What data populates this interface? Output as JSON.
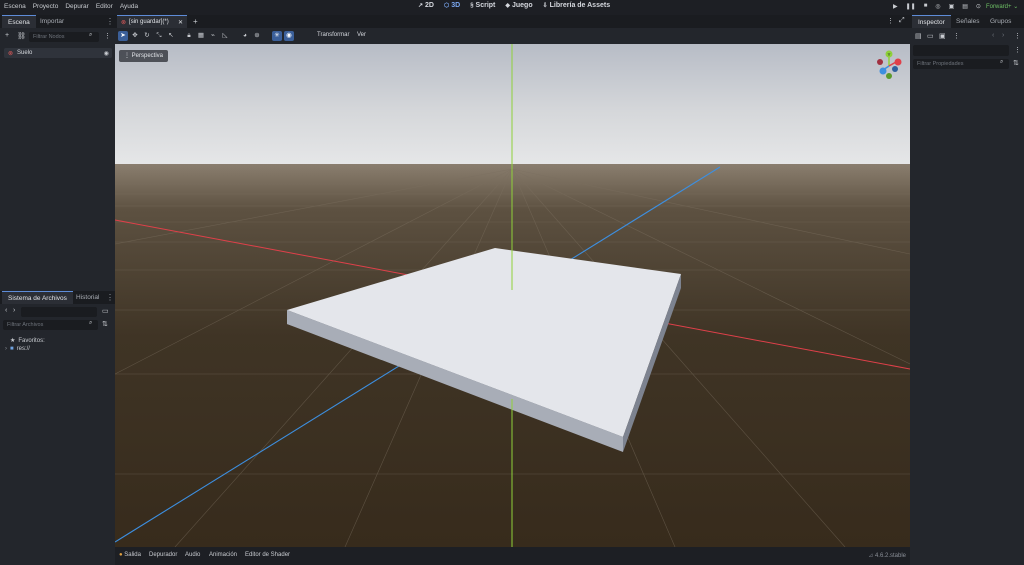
{
  "menubar": {
    "items": [
      "Escena",
      "Proyecto",
      "Depurar",
      "Editor",
      "Ayuda"
    ],
    "workspaces": [
      {
        "label": "2D",
        "icon": "2d-icon",
        "active": false
      },
      {
        "label": "3D",
        "icon": "3d-icon",
        "active": true
      },
      {
        "label": "Script",
        "icon": "script-icon",
        "active": false
      },
      {
        "label": "Juego",
        "icon": "game-icon",
        "active": false
      },
      {
        "label": "Librería de Assets",
        "icon": "assetlib-icon",
        "active": false
      }
    ],
    "renderer": "Forward+"
  },
  "scene_dock": {
    "tabs": [
      "Escena",
      "Importar"
    ],
    "filter_placeholder": "Filtrar Nodos",
    "tree": [
      {
        "label": "Suelo",
        "icon": "node3d-icon"
      }
    ]
  },
  "filesystem_dock": {
    "tabs": [
      "Sistema de Archivos",
      "Historial"
    ],
    "filter_placeholder": "Filtrar Archivos",
    "favorites_label": "Favoritos:",
    "root_label": "res://"
  },
  "editor": {
    "scene_tab_label": "[sin guardar](*)",
    "toolbar_menus": [
      "Transformar",
      "Ver"
    ],
    "perspective_label": "Perspectiva",
    "gizmo_labels": {
      "y": "Y"
    }
  },
  "inspector_dock": {
    "tabs": [
      "Inspector",
      "Señales",
      "Grupos"
    ],
    "filter_placeholder": "Filtrar Propiedades"
  },
  "bottom_panel": {
    "tabs": [
      "Salida",
      "Depurador",
      "Audio",
      "Animación",
      "Editor de Shader"
    ],
    "version": "4.6.2.stable"
  },
  "colors": {
    "accent": "#5e8cd8",
    "x_axis": "#e0404a",
    "y_axis": "#8fd13a",
    "z_axis": "#3d8fe0",
    "renderer": "#6ec165"
  }
}
